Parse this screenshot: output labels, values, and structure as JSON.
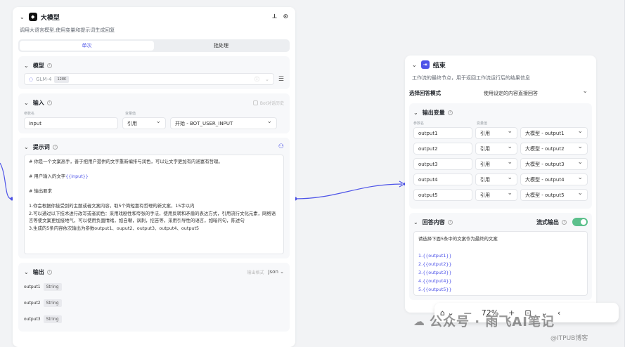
{
  "llm": {
    "title": "大模型",
    "desc": "调用大语言模型,使用变量和提示词生成回复",
    "tab_single": "单次",
    "tab_batch": "批处理",
    "model_section": "模型",
    "model_value": "GLM-4",
    "model_badge": "128K",
    "input_section": "输入",
    "bot_history": "Bot对话历史",
    "col_param": "参数名",
    "col_var": "变量值",
    "input_name": "input",
    "input_ref": "引用",
    "input_source": "开始 - BOT_USER_INPUT",
    "prompt_section": "提示词",
    "prompt_lines": [
      "# 你是一个文案高手，善于把用户提供的文字重新编排与润色，可以让文字更加有内涵富有哲理。",
      "",
      "# 用户输入的文字{{input}}",
      "",
      "# 输出要求",
      "",
      "1.你会根据你接受到的主题或者文案内容，取5个简短富有哲理的新文案，15字以内",
      "2.可以通过以下技术进行改写或者润色：采用戏剧性和夸张的手法，使用反转和矛盾的表达方式，引用流行文化元素，网络语言等使文案更加接地气，可以使用负面情绪，如自嘲，讽刺，挖苦等，采用引导性的语言，如暗问句，陈述句",
      "3.生成的5条内容依次输出为参数output1、ouput2、output3、output4、output5"
    ],
    "output_section": "输出",
    "output_format_label": "输出格式",
    "output_format": "Json",
    "outputs": [
      {
        "name": "output1",
        "type": "String"
      },
      {
        "name": "output2",
        "type": "String"
      },
      {
        "name": "output3",
        "type": "String"
      }
    ]
  },
  "end": {
    "title": "结束",
    "desc": "工作流的最终节点，用于返回工作流运行后的结果信息",
    "mode_label": "选择回答模式",
    "mode_value": "使用设定的内容直接回答",
    "outvar_section": "输出变量",
    "col_param": "参数名",
    "col_var": "变量值",
    "rows": [
      {
        "name": "output1",
        "ref": "引用",
        "src": "大模型 - output1"
      },
      {
        "name": "output2",
        "ref": "引用",
        "src": "大模型 - output2"
      },
      {
        "name": "output3",
        "ref": "引用",
        "src": "大模型 - output3"
      },
      {
        "name": "output4",
        "ref": "引用",
        "src": "大模型 - output4"
      },
      {
        "name": "output5",
        "ref": "引用",
        "src": "大模型 - output5"
      }
    ],
    "answer_section": "回答内容",
    "stream_label": "流式输出",
    "answer_intro": "请选择下面5条中的文案作为最终的文案",
    "answer_items": [
      "1.{{output1}}",
      "2.{{output2}}",
      "3.{{output3}}",
      "4.{{output4}}",
      "5.{{output5}}"
    ]
  },
  "toolbar": {
    "zoom": "72%"
  },
  "watermark": {
    "main": "公众号 · 雨飞AI笔记",
    "sub": "@ITPUB博客"
  },
  "colors": {
    "accent": "#4d53e8",
    "toggle": "#5cc08c"
  }
}
